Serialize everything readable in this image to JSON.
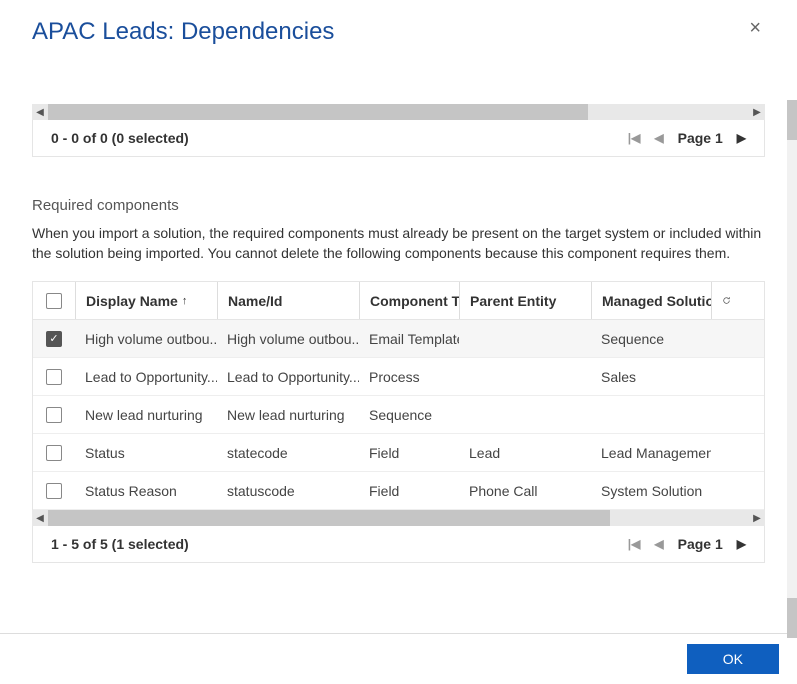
{
  "dialog": {
    "title": "APAC Leads: Dependencies",
    "close_icon": "×"
  },
  "topPager": {
    "range": "0 - 0 of 0 (0 selected)",
    "page_label": "Page 1"
  },
  "required": {
    "title": "Required components",
    "description": "When you import a solution, the required components must already be present on the target system or included within the solution being imported. You cannot delete the following components because this component requires them."
  },
  "grid": {
    "headers": {
      "display_name": "Display Name",
      "name_id": "Name/Id",
      "component_type": "Component T...",
      "parent_entity": "Parent Entity",
      "managed_solution": "Managed Solution"
    },
    "sort_arrow": "↑",
    "rows": [
      {
        "checked": true,
        "display_name": "High volume outbou...",
        "name_id": "High volume outbou...",
        "component_type": "Email Template",
        "parent_entity": "",
        "managed_solution": "Sequence"
      },
      {
        "checked": false,
        "display_name": "Lead to Opportunity...",
        "name_id": "Lead to Opportunity...",
        "component_type": "Process",
        "parent_entity": "",
        "managed_solution": "Sales"
      },
      {
        "checked": false,
        "display_name": "New lead nurturing",
        "name_id": "New lead nurturing",
        "component_type": "Sequence",
        "parent_entity": "",
        "managed_solution": ""
      },
      {
        "checked": false,
        "display_name": "Status",
        "name_id": "statecode",
        "component_type": "Field",
        "parent_entity": "Lead",
        "managed_solution": "Lead Management"
      },
      {
        "checked": false,
        "display_name": "Status Reason",
        "name_id": "statuscode",
        "component_type": "Field",
        "parent_entity": "Phone Call",
        "managed_solution": "System Solution"
      }
    ]
  },
  "bottomPager": {
    "range": "1 - 5 of 5 (1 selected)",
    "page_label": "Page 1"
  },
  "footer": {
    "ok_label": "OK"
  },
  "icons": {
    "first": "|◀",
    "prev": "◀",
    "next": "▶",
    "scroll_left": "◀",
    "scroll_right": "▶",
    "check": "✓"
  }
}
